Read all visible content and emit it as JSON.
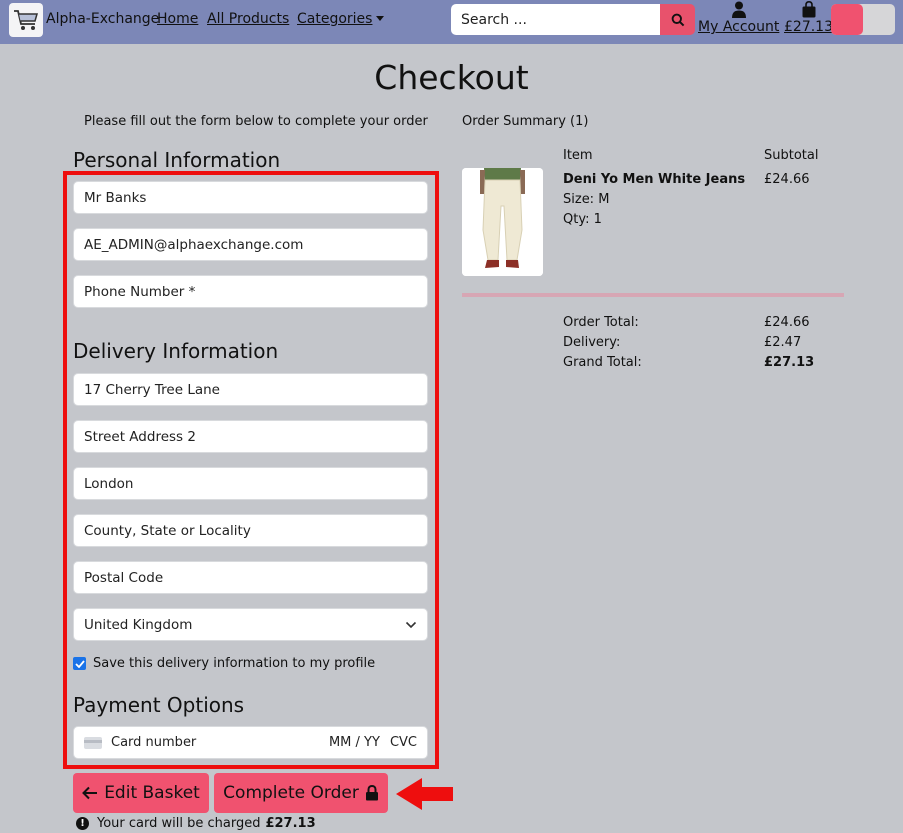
{
  "nav": {
    "brand": "Alpha-Exchange",
    "links": [
      "Home",
      "All Products",
      "Categories"
    ],
    "search_placeholder": "Search ...",
    "account_label": "My Account",
    "basket_total": "£27.13"
  },
  "page": {
    "title": "Checkout",
    "form_intro": "Please fill out the form below to complete your order"
  },
  "personal": {
    "heading": "Personal Information",
    "full_name": "Mr Banks",
    "email": "AE_ADMIN@alphaexchange.com",
    "phone_placeholder": "Phone Number *"
  },
  "delivery": {
    "heading": "Delivery Information",
    "street1": "17 Cherry Tree Lane",
    "street2_placeholder": "Street Address 2",
    "town": "London",
    "county_placeholder": "County, State or Locality",
    "postcode_placeholder": "Postal Code",
    "country": "United Kingdom",
    "save_label": "Save this delivery information to my profile",
    "save_checked": true
  },
  "payment": {
    "heading": "Payment Options",
    "card_placeholder": "Card number",
    "expiry_placeholder": "MM / YY",
    "cvc_placeholder": "CVC"
  },
  "actions": {
    "edit_basket": "Edit Basket",
    "complete_order": "Complete Order",
    "charge_note_prefix": "Your card will be charged",
    "charge_amount": "£27.13"
  },
  "summary": {
    "title": "Order Summary (1)",
    "col_item": "Item",
    "col_subtotal": "Subtotal",
    "product": {
      "name": "Deni Yo Men White Jeans",
      "size": "Size: M",
      "qty": "Qty: 1",
      "subtotal": "£24.66"
    },
    "order_total_label": "Order Total:",
    "order_total": "£24.66",
    "delivery_label": "Delivery:",
    "delivery": "£2.47",
    "grand_total_label": "Grand Total:",
    "grand_total": "£27.13"
  },
  "colors": {
    "navbar": "#7c87b7",
    "accent": "#f0526f",
    "highlight": "#ee0e0e",
    "background": "#c4c6cb"
  }
}
